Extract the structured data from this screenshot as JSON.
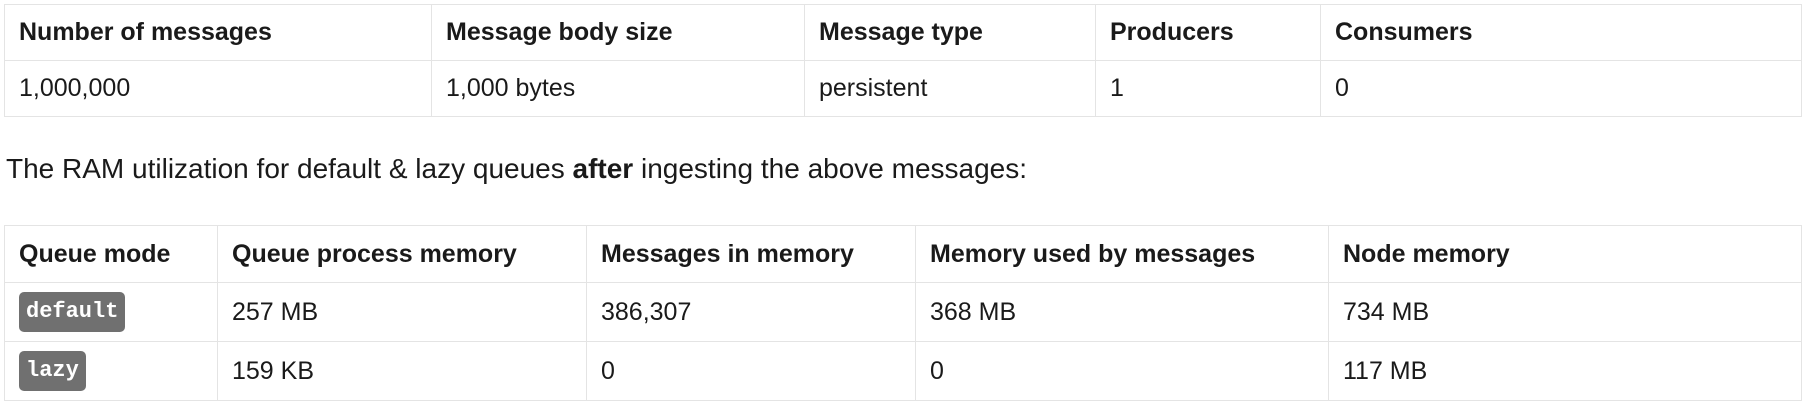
{
  "test_table": {
    "headers": [
      "Number of messages",
      "Message body size",
      "Message type",
      "Producers",
      "Consumers"
    ],
    "row": [
      "1,000,000",
      "1,000 bytes",
      "persistent",
      "1",
      "0"
    ]
  },
  "intro": {
    "before": "The RAM utilization for default & lazy queues ",
    "bold": "after",
    "after": " ingesting the above messages:"
  },
  "results_table": {
    "headers": [
      "Queue mode",
      "Queue process memory",
      "Messages in memory",
      "Memory used by messages",
      "Node memory"
    ],
    "rows": [
      [
        "default",
        "257 MB",
        "386,307",
        "368 MB",
        "734 MB"
      ],
      [
        "lazy",
        "159 KB",
        "0",
        "0",
        "117 MB"
      ]
    ]
  }
}
